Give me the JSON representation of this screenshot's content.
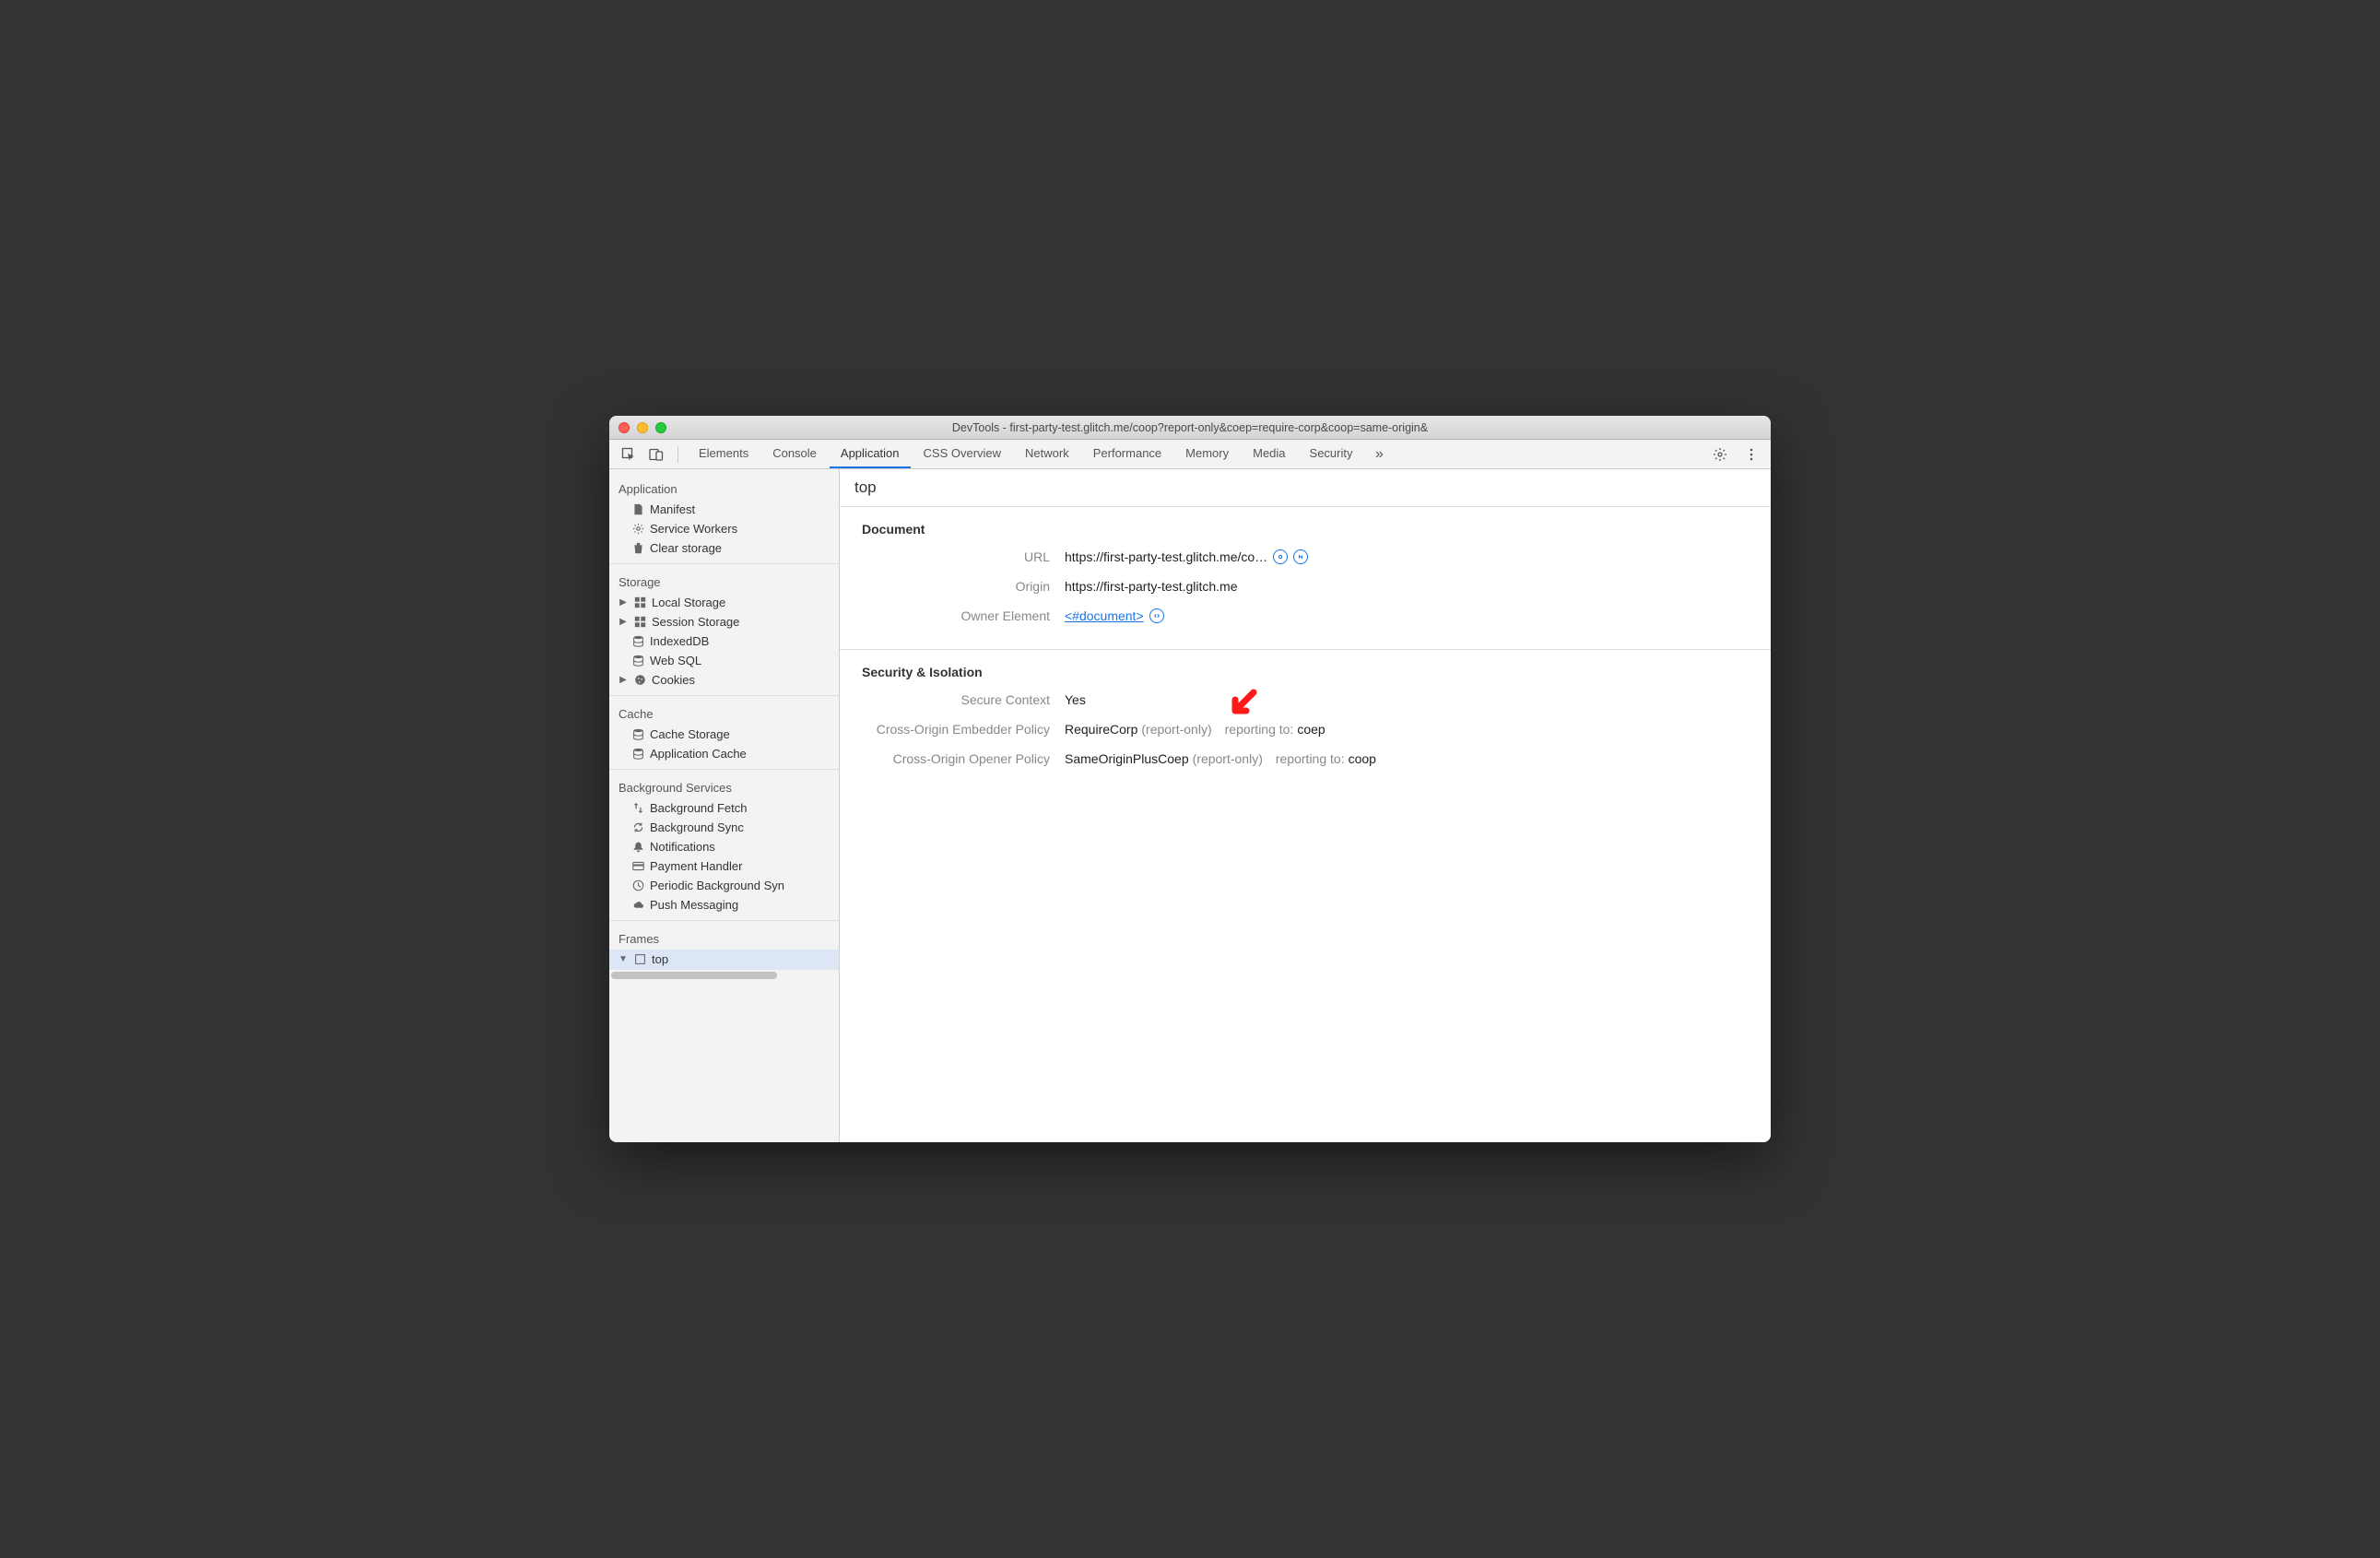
{
  "window": {
    "title": "DevTools - first-party-test.glitch.me/coop?report-only&coep=require-corp&coop=same-origin&"
  },
  "tabs": [
    "Elements",
    "Console",
    "Application",
    "CSS Overview",
    "Network",
    "Performance",
    "Memory",
    "Media",
    "Security"
  ],
  "active_tab": "Application",
  "sidebar": {
    "groups": [
      {
        "title": "Application",
        "items": [
          {
            "icon": "file-icon",
            "label": "Manifest"
          },
          {
            "icon": "gear-icon",
            "label": "Service Workers"
          },
          {
            "icon": "trash-icon",
            "label": "Clear storage"
          }
        ]
      },
      {
        "title": "Storage",
        "items": [
          {
            "arrow": true,
            "icon": "grid-icon",
            "label": "Local Storage"
          },
          {
            "arrow": true,
            "icon": "grid-icon",
            "label": "Session Storage"
          },
          {
            "icon": "db-icon",
            "label": "IndexedDB"
          },
          {
            "icon": "db-icon",
            "label": "Web SQL"
          },
          {
            "arrow": true,
            "icon": "cookie-icon",
            "label": "Cookies"
          }
        ]
      },
      {
        "title": "Cache",
        "items": [
          {
            "icon": "db-icon",
            "label": "Cache Storage"
          },
          {
            "icon": "db-icon",
            "label": "Application Cache"
          }
        ]
      },
      {
        "title": "Background Services",
        "items": [
          {
            "icon": "fetch-icon",
            "label": "Background Fetch"
          },
          {
            "icon": "sync-icon",
            "label": "Background Sync"
          },
          {
            "icon": "bell-icon",
            "label": "Notifications"
          },
          {
            "icon": "card-icon",
            "label": "Payment Handler"
          },
          {
            "icon": "clock-icon",
            "label": "Periodic Background Syn"
          },
          {
            "icon": "cloud-icon",
            "label": "Push Messaging"
          }
        ]
      },
      {
        "title": "Frames",
        "items": [
          {
            "arrow": true,
            "down": true,
            "icon": "frame-icon",
            "label": "top",
            "selected": true
          }
        ]
      }
    ]
  },
  "main": {
    "header": "top",
    "sections": [
      {
        "title": "Document",
        "rows": [
          {
            "key": "URL",
            "type": "url",
            "value": "https://first-party-test.glitch.me/co…"
          },
          {
            "key": "Origin",
            "type": "text",
            "value": "https://first-party-test.glitch.me"
          },
          {
            "key": "Owner Element",
            "type": "owner",
            "value": "<#document>"
          }
        ]
      },
      {
        "title": "Security & Isolation",
        "rows": [
          {
            "key": "Secure Context",
            "type": "text",
            "value": "Yes"
          },
          {
            "key": "Cross-Origin Embedder Policy",
            "type": "policy",
            "value": "RequireCorp",
            "note": "(report-only)",
            "reporting_label": "reporting to:",
            "reporting_to": "coep",
            "annot": true
          },
          {
            "key": "Cross-Origin Opener Policy",
            "type": "policy",
            "value": "SameOriginPlusCoep",
            "note": "(report-only)",
            "reporting_label": "reporting to:",
            "reporting_to": "coop"
          }
        ]
      }
    ]
  }
}
